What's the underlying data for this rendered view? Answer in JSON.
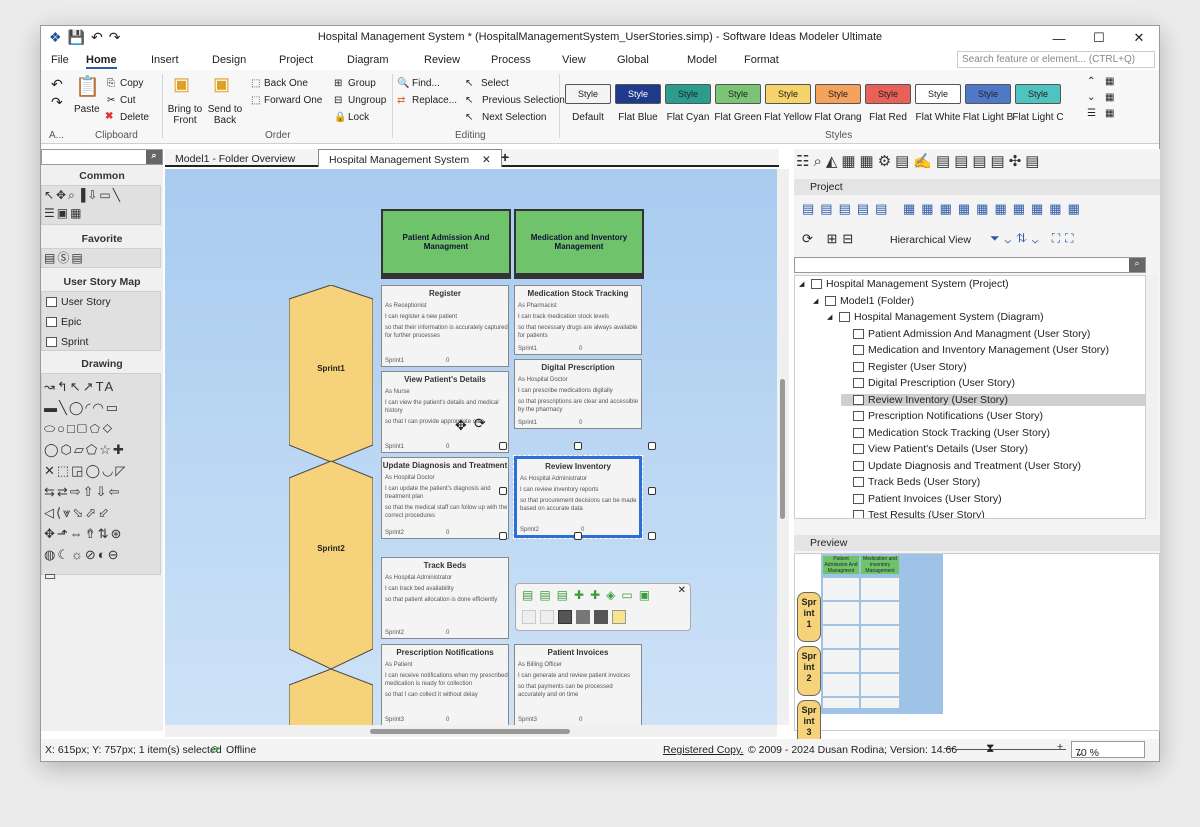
{
  "window": {
    "title": "Hospital Management System *  (HospitalManagementSystem_UserStories.simp)  - Software Ideas Modeler Ultimate"
  },
  "menu": [
    "File",
    "Home",
    "Insert",
    "Design",
    "Project",
    "Diagram",
    "Review",
    "Process",
    "View",
    "Global",
    "Model",
    "Format"
  ],
  "search_placeholder": "Search feature or element... (CTRL+Q)",
  "ribbon": {
    "clipboard": {
      "paste": "Paste",
      "copy": "Copy",
      "cut": "Cut",
      "delete": "Delete",
      "group": "Clipboard",
      "a": "A..."
    },
    "order": {
      "bring_front": "Bring to Front",
      "send_back": "Send to Back",
      "back_one": "Back One",
      "forward_one": "Forward One",
      "group_label": "Order"
    },
    "grouping": {
      "group": "Group",
      "ungroup": "Ungroup",
      "lock": "Lock"
    },
    "editing": {
      "find": "Find...",
      "replace": "Replace...",
      "select": "Select",
      "prev": "Previous Selection",
      "next": "Next Selection",
      "group": "Editing"
    },
    "styles": {
      "group": "Styles",
      "items": [
        {
          "btn": "Style",
          "label": "Default",
          "bg": "#f4f4f4",
          "fg": "#222"
        },
        {
          "btn": "Style",
          "label": "Flat Blue",
          "bg": "#1f3a8a",
          "fg": "#fff"
        },
        {
          "btn": "Style",
          "label": "Flat Cyan",
          "bg": "#2a9d8f",
          "fg": "#222"
        },
        {
          "btn": "Style",
          "label": "Flat Green",
          "bg": "#7cc576",
          "fg": "#222"
        },
        {
          "btn": "Style",
          "label": "Flat Yellow",
          "bg": "#f6d36b",
          "fg": "#222"
        },
        {
          "btn": "Style",
          "label": "Flat Orang",
          "bg": "#f5a25d",
          "fg": "#222"
        },
        {
          "btn": "Style",
          "label": "Flat Red",
          "bg": "#e8605a",
          "fg": "#222"
        },
        {
          "btn": "Style",
          "label": "Flat White",
          "bg": "#ffffff",
          "fg": "#222"
        },
        {
          "btn": "Style",
          "label": "Flat Light B",
          "bg": "#4f79c8",
          "fg": "#222"
        },
        {
          "btn": "Style",
          "label": "Flat Light C",
          "bg": "#4ec3c0",
          "fg": "#222"
        }
      ]
    }
  },
  "left": {
    "common": "Common",
    "favorite": "Favorite",
    "usm": "User Story Map",
    "user_story": "User Story",
    "epic": "Epic",
    "sprint": "Sprint",
    "drawing": "Drawing"
  },
  "tabs": [
    {
      "label": "Model1 - Folder Overview"
    },
    {
      "label": "Hospital Management System"
    }
  ],
  "diagram": {
    "headers": [
      "Patient Admission And Managment",
      "Medication and Inventory Management"
    ],
    "sprints": [
      "Sprint1",
      "Sprint2"
    ],
    "cards": [
      {
        "title": "Register",
        "as": "As Receptionist",
        "want": "I can register a new patient",
        "so": "so that their information is accurately captured for further processes",
        "sprint": "Sprint1",
        "num": "0"
      },
      {
        "title": "Medication Stock Tracking",
        "as": "As Pharmacist",
        "want": "I can track medication stock levels",
        "so": "so that necessary drugs are always available for patients",
        "sprint": "Sprint1",
        "num": "0"
      },
      {
        "title": "View Patient's Details",
        "as": "As Nurse",
        "want": "I can view the patient's details and medical history",
        "so": "so that I can provide appropriate care",
        "sprint": "Sprint1",
        "num": "0"
      },
      {
        "title": "Digital Prescription",
        "as": "As Hospital Doctor",
        "want": "I can prescribe medications digitally",
        "so": "so that prescriptions are clear and accessible by the pharmacy",
        "sprint": "Sprint1",
        "num": "0"
      },
      {
        "title": "Update Diagnosis and Treatment",
        "as": "As Hospital Doctor",
        "want": "I can update the patient's diagnosis and treatment plan",
        "so": "so that the medical staff can follow up with the correct procedures",
        "sprint": "Sprint2",
        "num": "0"
      },
      {
        "title": "Review Inventory",
        "as": "As Hospital Administrator",
        "want": "I can review inventory reports",
        "so": "so that procurement decisions can be made based on accurate data",
        "sprint": "Sprint2",
        "num": "0"
      },
      {
        "title": "Track Beds",
        "as": "As Hospital Administrator",
        "want": "I can track bed availability",
        "so": "so that patient allocation is done efficiently",
        "sprint": "Sprint2",
        "num": "0"
      },
      {
        "title": "Patient Invoices",
        "as": "As Billing Officer",
        "want": "I can generate and review patient invoices",
        "so": "so that payments can be processed accurately and on time",
        "sprint": "Sprint3",
        "num": "0"
      },
      {
        "title": "Prescription Notifications",
        "as": "As Patient",
        "want": "I can receive notifications when my prescribed medication is ready for collection",
        "so": "so that I can collect it without delay",
        "sprint": "Sprint3",
        "num": "0"
      }
    ]
  },
  "right": {
    "project_title": "Project",
    "view": "Hierarchical View",
    "preview_title": "Preview",
    "tree": [
      {
        "label": "Hospital Management System (Project)",
        "level": 0
      },
      {
        "label": "Model1 (Folder)",
        "level": 1
      },
      {
        "label": "Hospital Management System (Diagram)",
        "level": 2
      },
      {
        "label": "Patient Admission And Managment (User Story)",
        "level": 3
      },
      {
        "label": "Medication and Inventory Management (User Story)",
        "level": 3
      },
      {
        "label": "Register (User Story)",
        "level": 3
      },
      {
        "label": "Digital Prescription (User Story)",
        "level": 3
      },
      {
        "label": "Review Inventory (User Story)",
        "level": 3,
        "selected": true
      },
      {
        "label": "Prescription Notifications (User Story)",
        "level": 3
      },
      {
        "label": "Medication Stock Tracking (User Story)",
        "level": 3
      },
      {
        "label": "View Patient's Details (User Story)",
        "level": 3
      },
      {
        "label": "Update Diagnosis and Treatment (User Story)",
        "level": 3
      },
      {
        "label": "Track Beds (User Story)",
        "level": 3
      },
      {
        "label": "Patient Invoices (User Story)",
        "level": 3
      },
      {
        "label": "Test Results (User Story)",
        "level": 3
      }
    ],
    "preview_sprints": [
      "Spr",
      "int",
      "1",
      "Spr",
      "int",
      "2",
      "Spr",
      "int",
      "3"
    ]
  },
  "status": {
    "coords": "X: 615px; Y: 757px; 1 item(s) selected",
    "offline": "Offline",
    "registered": "Registered Copy.",
    "copyright": "© 2009 - 2024 Dusan Rodina; Version: 14.66",
    "zoom": "70 %"
  }
}
